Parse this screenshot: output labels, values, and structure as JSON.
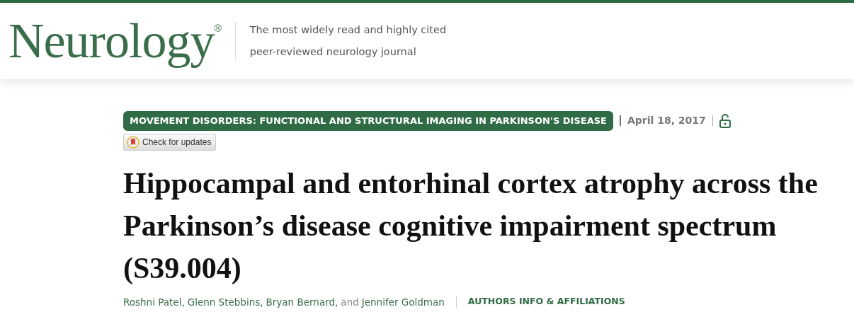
{
  "header": {
    "logo": "Neurology$^{®}$",
    "tagline": "The most widely read and highly cited peer-reviewed neurology journal"
  },
  "article": {
    "section": "MOVEMENT DISORDERS: FUNCTIONAL AND STRUCTURAL IMAGING IN PARKINSON'S DISEASE",
    "date": "April 18, 2017",
    "check_updates": "Check for updates",
    "title": "Hippocampal and entorhinal cortex atrophy across the Parkinson’s disease cognitive impairment spectrum (S39.004)",
    "authors": [
      {
        "name": "Roshni Patel,"
      },
      {
        "name": "Glenn Stebbins,"
      },
      {
        "name": "Bryan Bernard,"
      },
      {
        "name": "Jennifer Goldman"
      }
    ],
    "authors_conjunction": "and",
    "authors_info": "AUTHORS INFO & AFFILIATIONS"
  }
}
